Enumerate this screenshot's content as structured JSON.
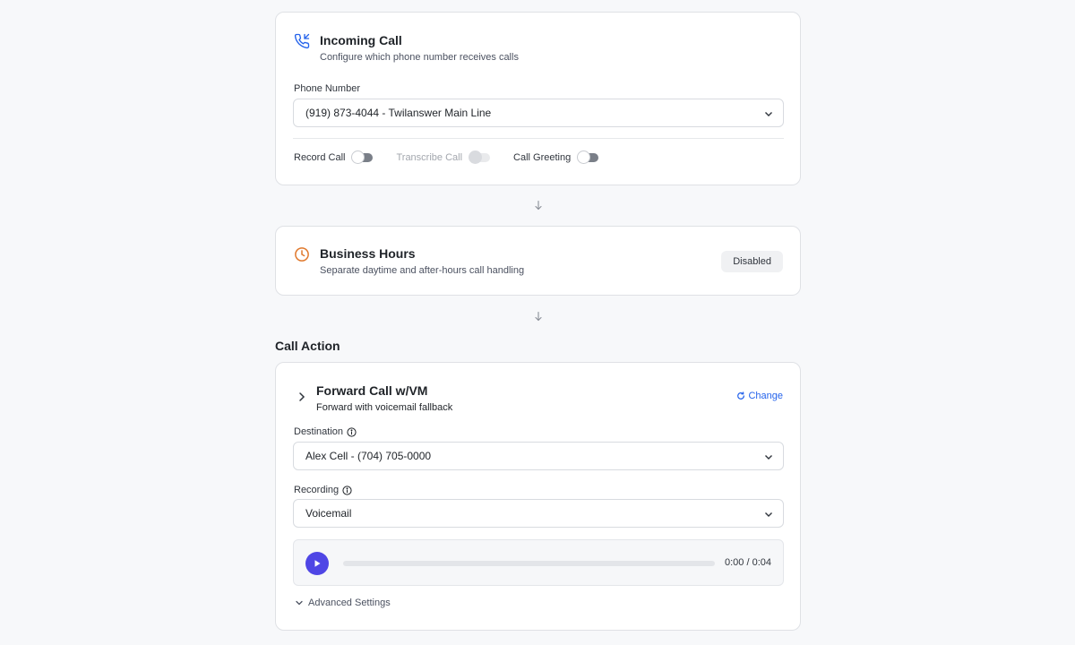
{
  "incoming_call": {
    "title": "Incoming Call",
    "subtitle": "Configure which phone number receives calls",
    "phone_label": "Phone Number",
    "phone_value": "(919) 873-4044 - Twilanswer Main Line",
    "toggles": [
      {
        "label": "Record Call",
        "on": false,
        "disabled": false
      },
      {
        "label": "Transcribe Call",
        "on": false,
        "disabled": true
      },
      {
        "label": "Call Greeting",
        "on": false,
        "disabled": false
      }
    ]
  },
  "business_hours": {
    "title": "Business Hours",
    "subtitle": "Separate daytime and after-hours call handling",
    "badge": "Disabled"
  },
  "call_action": {
    "section_title": "Call Action",
    "title": "Forward Call w/VM",
    "subtitle": "Forward with voicemail fallback",
    "change_label": "Change",
    "destination_label": "Destination",
    "destination_value": "Alex Cell - (704) 705-0000",
    "recording_label": "Recording",
    "recording_value": "Voicemail",
    "player_time": "0:00 / 0:04",
    "player_progress": 0,
    "advanced_label": "Advanced Settings"
  },
  "icons": {
    "incoming": "phone-incoming-icon",
    "clock": "clock-icon",
    "info": "info-icon",
    "chevron_down": "chevron-down-icon",
    "chevron_right": "chevron-right-icon",
    "refresh": "refresh-icon",
    "play": "play-icon",
    "arrow_down": "arrow-down-icon"
  },
  "colors": {
    "accent": "#2563eb",
    "play": "#4f46e5",
    "clock": "#e0782c",
    "phone": "#2563eb"
  }
}
